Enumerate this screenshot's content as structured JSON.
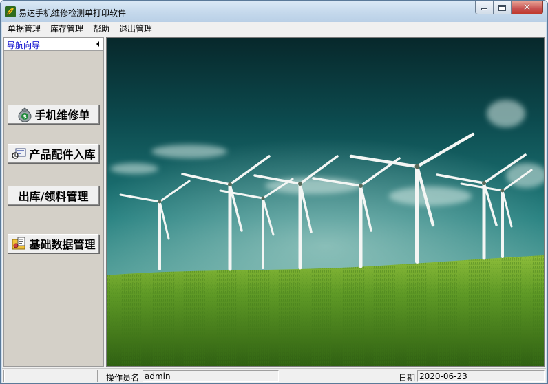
{
  "window": {
    "title": "易达手机维修检测单打印软件",
    "icon": "app-leaf-icon"
  },
  "menu": [
    "单据管理",
    "库存管理",
    "帮助",
    "退出管理"
  ],
  "sidebar": {
    "title": "导航向导",
    "buttons": [
      {
        "label": "手机维修单",
        "icon": "money-bag-icon"
      },
      {
        "label": "产品配件入库",
        "icon": "product-import-icon"
      },
      {
        "label": "出库/领料管理",
        "icon": ""
      },
      {
        "label": "基础数据管理",
        "icon": "folder-settings-icon"
      }
    ]
  },
  "main": {
    "image": "wind-turbine-landscape"
  },
  "status": {
    "operator_label": "操作员名",
    "operator_value": "admin",
    "date_label": "日期",
    "date_value": "2020-06-23"
  }
}
